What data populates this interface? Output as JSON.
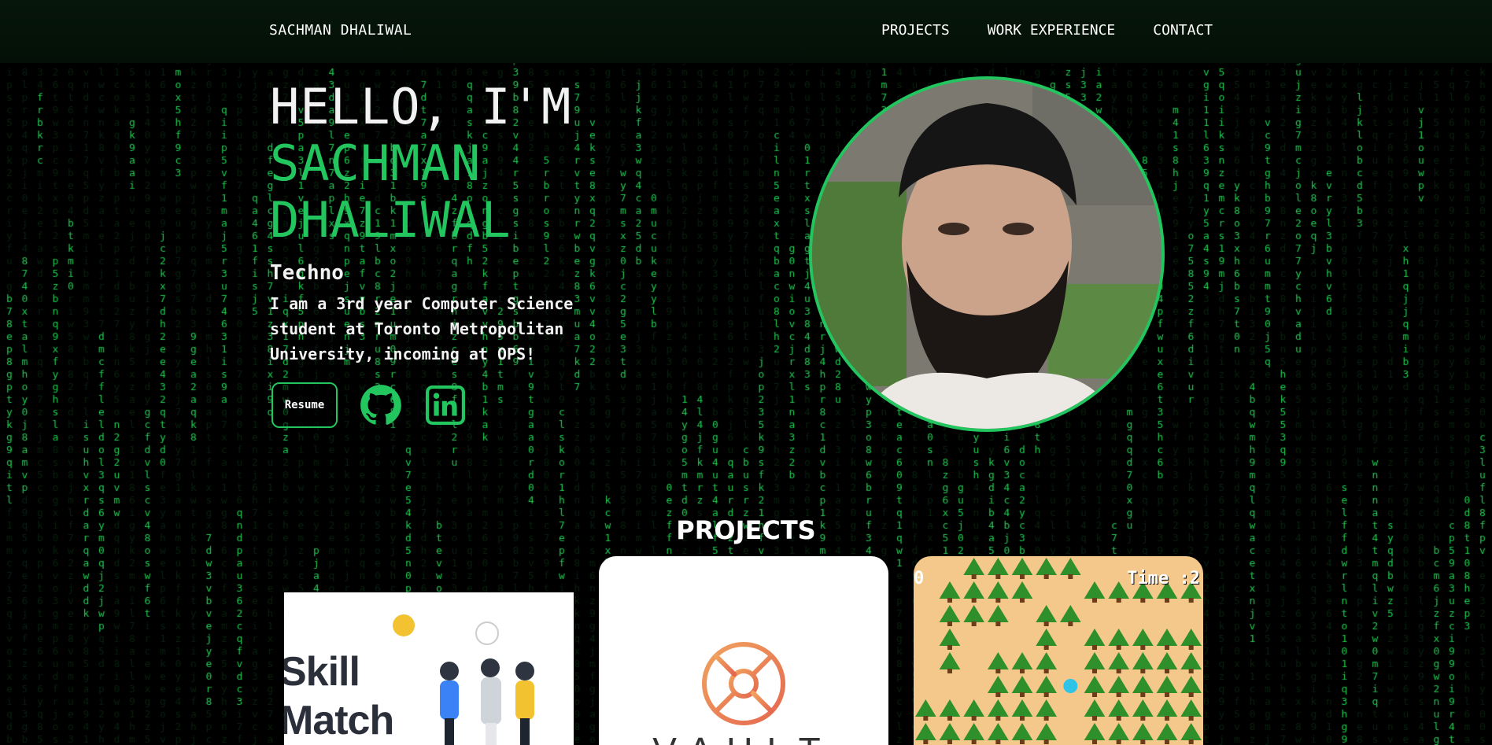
{
  "nav": {
    "brand": "SACHMAN DHALIWAL",
    "links": [
      "PROJECTS",
      "WORK EXPERIENCE",
      "CONTACT"
    ]
  },
  "hero": {
    "greeting": "HELLO, I'M",
    "name_line1": "SACHMAN",
    "name_line2": "DHALIWAL",
    "subtitle": "Techno",
    "bio": "I am a 3rd year Computer Science student at Toronto Metropolitan University, incoming at OPS!",
    "resume_label": "Resume"
  },
  "icons": {
    "github": "github-icon",
    "linkedin": "linkedin-icon"
  },
  "projects": {
    "title": "PROJECTS",
    "cards": [
      {
        "title": "Skill Match",
        "line1": "Skill",
        "line2": "Match"
      },
      {
        "title": "VAULT"
      },
      {
        "score": "0",
        "timer": "Time :2"
      }
    ]
  },
  "colors": {
    "accent": "#22c55e",
    "rain_bright": "#1fd655",
    "rain_dim": "#0f3d1c",
    "background": "#000000"
  }
}
